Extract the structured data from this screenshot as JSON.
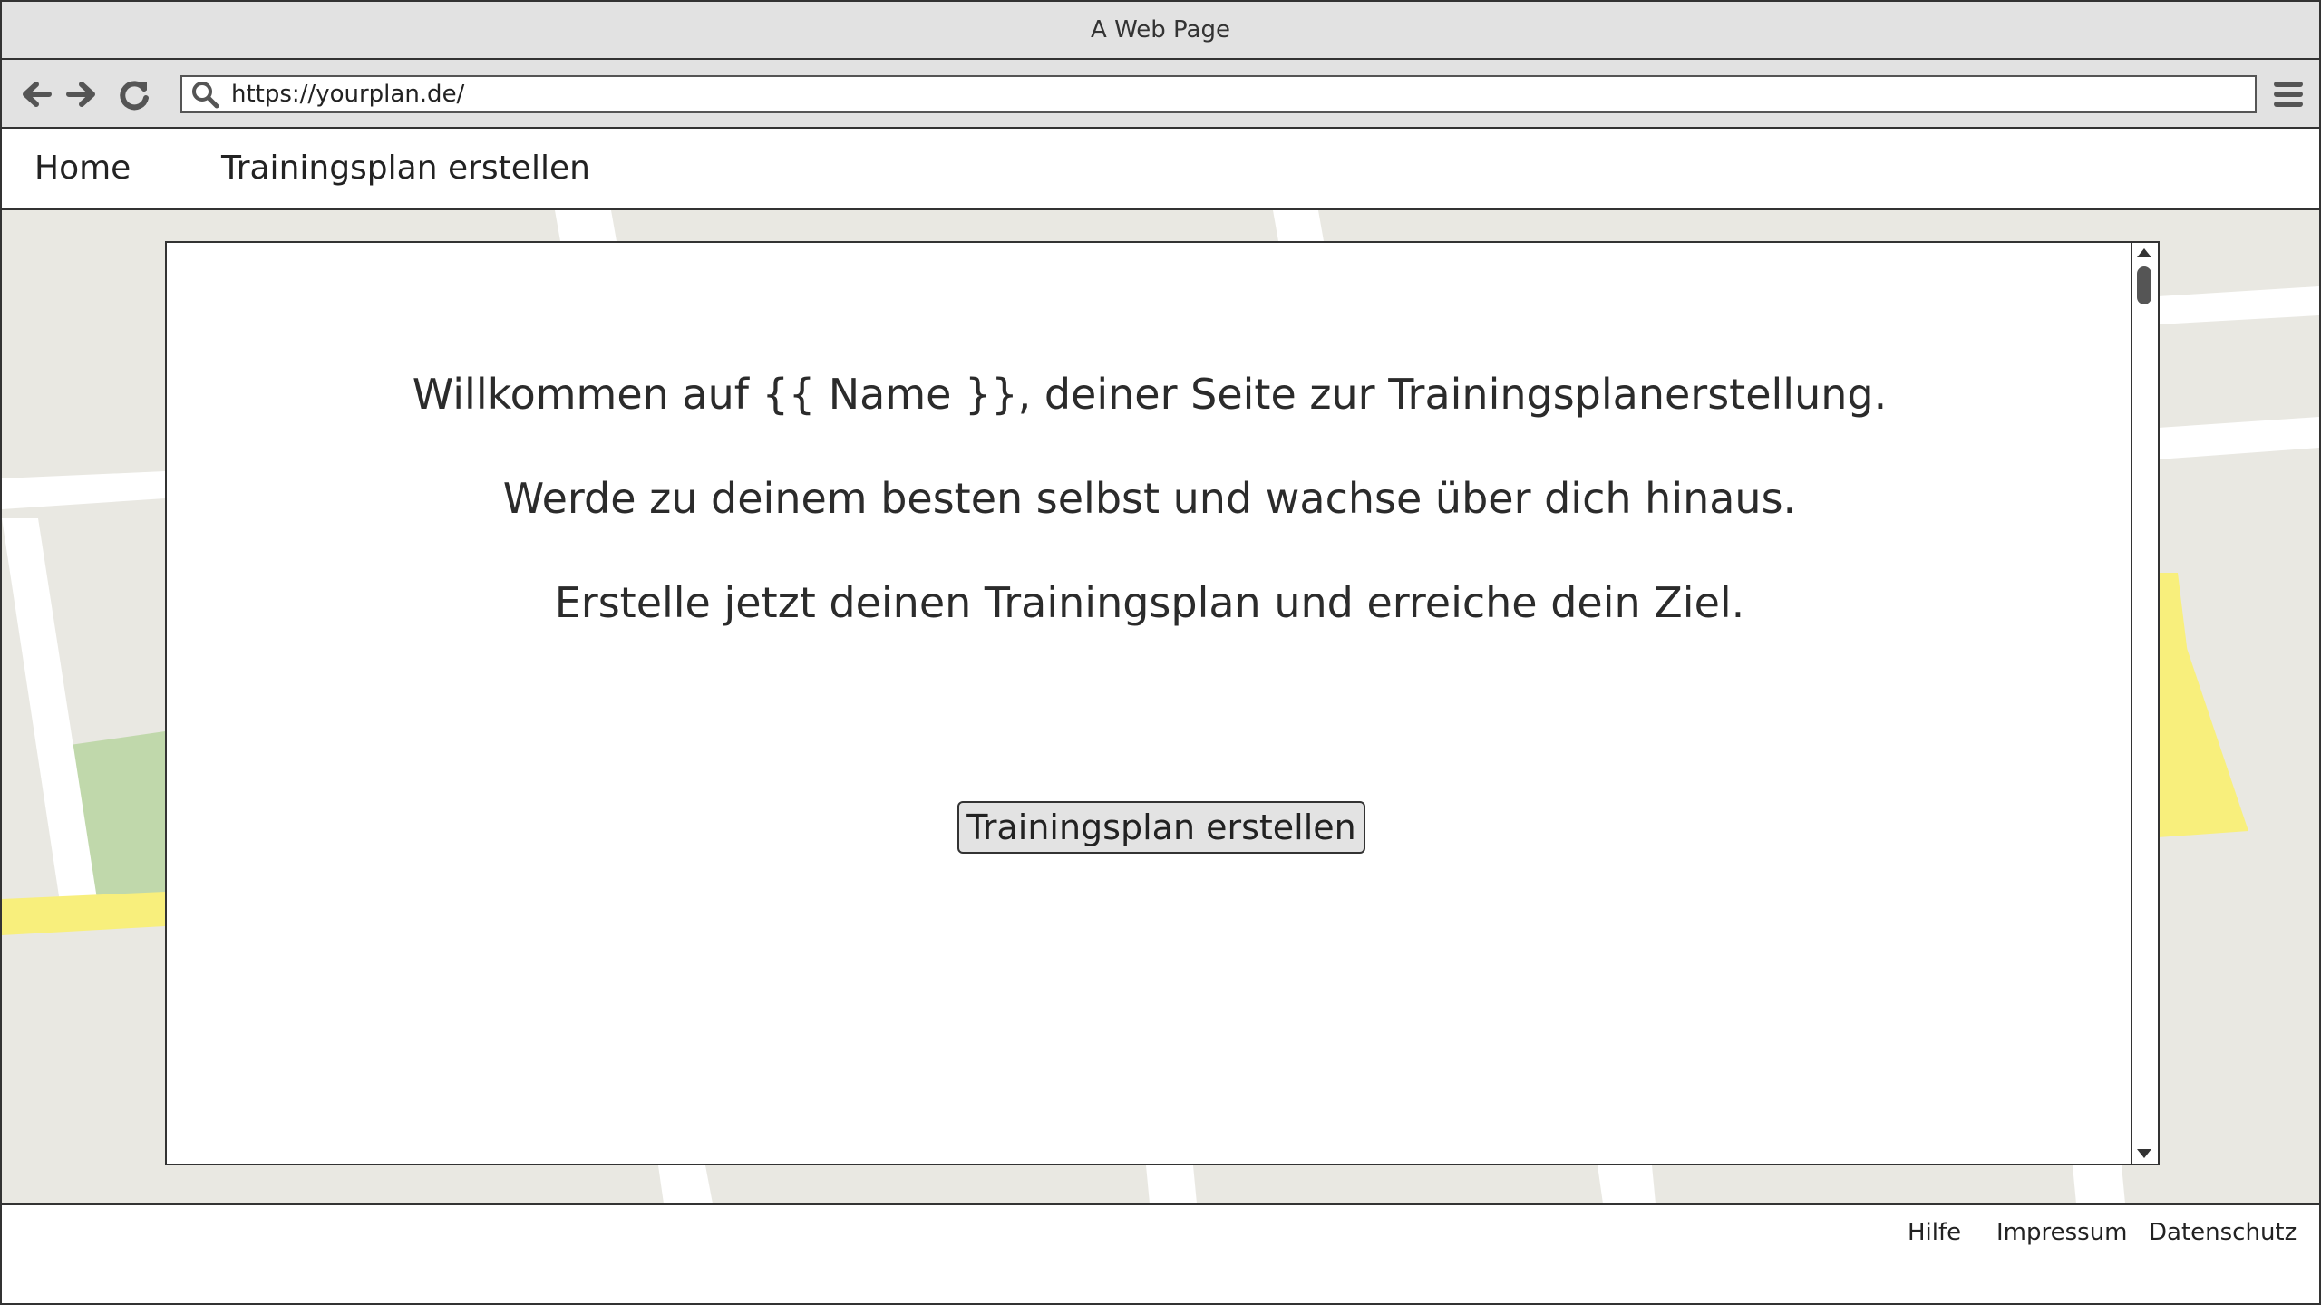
{
  "window": {
    "title": "A Web Page"
  },
  "browser": {
    "url": "https://yourplan.de/",
    "icons": [
      "back-arrow-icon",
      "forward-arrow-icon",
      "reload-icon",
      "search-icon",
      "hamburger-menu-icon"
    ]
  },
  "nav": {
    "items": [
      {
        "label": "Home"
      },
      {
        "label": "Trainingsplan erstellen"
      }
    ]
  },
  "main": {
    "lines": [
      "Willkommen auf {{ Name }}, deiner Seite zur Trainingsplanerstellung.",
      "Werde zu deinem besten selbst und wachse über dich hinaus.",
      "Erstelle jetzt deinen Trainingsplan und erreiche dein Ziel."
    ],
    "cta_label": "Trainingsplan erstellen"
  },
  "footer": {
    "links": [
      {
        "label": "Hilfe"
      },
      {
        "label": "Impressum"
      },
      {
        "label": "Datenschutz"
      }
    ]
  },
  "colors": {
    "map_background": "#e9e8e2",
    "map_road": "#ffffff",
    "map_highway": "#f8ef7c",
    "map_park": "#c0d8ab",
    "chrome": "#e2e2e2"
  }
}
